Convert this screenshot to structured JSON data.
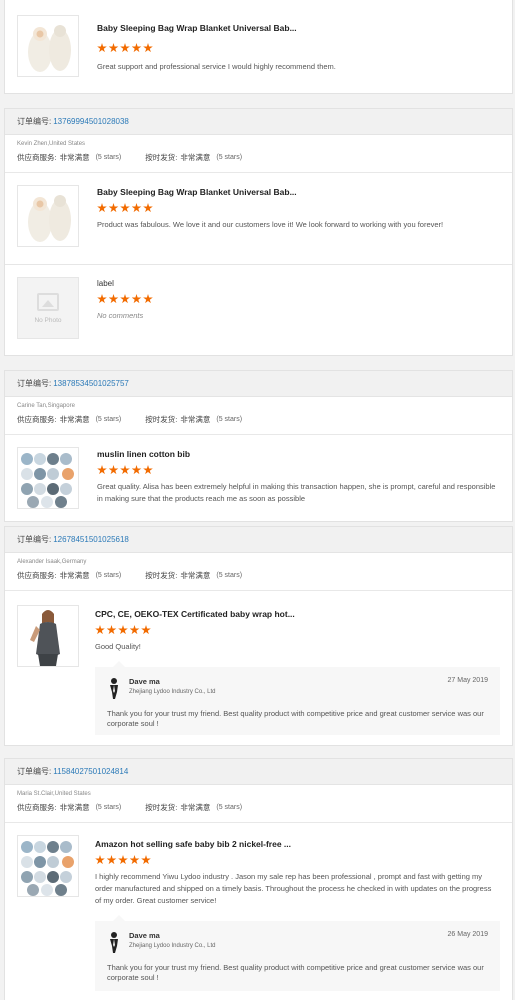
{
  "order_label": "订单编号:",
  "rating_labels": {
    "supplier_service": "供应商服务:",
    "on_time_delivery": "按时发货:",
    "very_satisfied": "非常满意",
    "five_stars": "(5 stars)"
  },
  "top_item": {
    "title": "Baby Sleeping Bag Wrap Blanket Universal Bab...",
    "comment": "Great support and professional service I would highly recommend them."
  },
  "orders": [
    {
      "number": "13769994501028038",
      "buyer": "Kevin Zhen,United States",
      "items": [
        {
          "title": "Baby Sleeping Bag Wrap Blanket Universal Bab...",
          "comment": "Product was fabulous. We love it and our customers love it! We look forward to working with you forever!"
        },
        {
          "title": "label",
          "comment": "No comments",
          "no_photo": "No Photo"
        }
      ]
    },
    {
      "number": "13878534501025757",
      "buyer": "Carine Tan,Singapore",
      "items": [
        {
          "title": "muslin linen cotton bib",
          "comment": "Great quality. Alisa has been extremely helpful in making this transaction happen, she is prompt, careful and responsible in making sure that the products reach me as soon as possible"
        }
      ]
    },
    {
      "number": "12678451501025618",
      "buyer": "Alexander Isaak,Germany",
      "items": [
        {
          "title": "CPC, CE, OEKO-TEX Certificated baby wrap hot...",
          "comment": "Good Quality!",
          "reply": {
            "name": "Dave ma",
            "company": "Zhejiang Lydoo Industry Co., Ltd",
            "date": "27 May 2019",
            "text": "Thank you for your trust my friend. Best quality product with competitive price and great customer service was our corporate soul !"
          }
        }
      ]
    },
    {
      "number": "11584027501024814",
      "buyer": "Maria St.Clair,United States",
      "items": [
        {
          "title": "Amazon hot selling safe baby bib 2 nickel-free ...",
          "comment": "I highly recommend Yiwu Lydoo industry . Jason my sale rep has been professional , prompt and fast with getting my order manufactured and shipped on a timely basis. Throughout the process he checked in with updates on the progress of my order. Great customer service!",
          "reply": {
            "name": "Dave ma",
            "company": "Zhejiang Lydoo Industry Co., Ltd",
            "date": "26 May 2019",
            "text": "Thank you for your trust my friend. Best quality product with competitive price and great customer service was our corporate soul !"
          }
        }
      ]
    }
  ],
  "colors": {
    "star": "#f26b00",
    "order_number": "#2c7ab8"
  },
  "icons": {
    "star": "star-icon",
    "no_photo": "image-placeholder-icon",
    "avatar": "user-avatar-icon"
  }
}
